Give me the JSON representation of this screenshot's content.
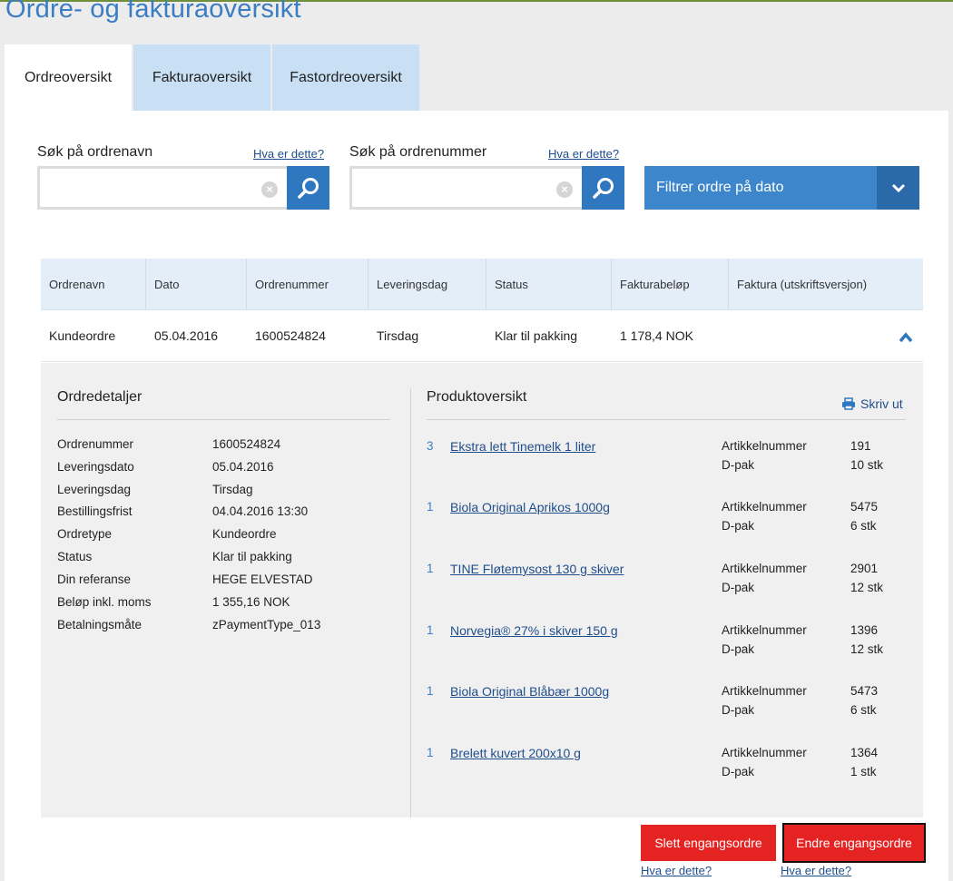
{
  "page": {
    "title": "Ordre- og fakturaoversikt"
  },
  "tabs": [
    {
      "label": "Ordreoversikt",
      "active": true
    },
    {
      "label": "Fakturaoversikt",
      "active": false
    },
    {
      "label": "Fastordreoversikt",
      "active": false
    }
  ],
  "search": {
    "order_name": {
      "label": "Søk på ordrenavn",
      "help": "Hva er dette?",
      "value": "",
      "placeholder": ""
    },
    "order_number": {
      "label": "Søk på ordrenummer",
      "help": "Hva er dette?",
      "value": "",
      "placeholder": ""
    },
    "date_filter_label": "Filtrer ordre på dato"
  },
  "table": {
    "headers": [
      "Ordrenavn",
      "Dato",
      "Ordrenummer",
      "Leveringsdag",
      "Status",
      "Fakturabeløp",
      "Faktura (utskriftsversjon)"
    ],
    "rows": [
      {
        "ordrenavn": "Kundeordre",
        "dato": "05.04.2016",
        "ordrenummer": "1600524824",
        "leveringsdag": "Tirsdag",
        "status": "Klar til pakking",
        "fakturabelop": "1 178,4 NOK",
        "faktura": ""
      }
    ]
  },
  "order_details": {
    "title": "Ordredetaljer",
    "fields": [
      {
        "key": "Ordrenummer",
        "value": "1600524824"
      },
      {
        "key": "Leveringsdato",
        "value": "05.04.2016"
      },
      {
        "key": "Leveringsdag",
        "value": "Tirsdag"
      },
      {
        "key": "Bestillingsfrist",
        "value": "04.04.2016 13:30"
      },
      {
        "key": "Ordretype",
        "value": "Kundeordre"
      },
      {
        "key": "Status",
        "value": "Klar til pakking"
      },
      {
        "key": "Din referanse",
        "value": "HEGE ELVESTAD"
      },
      {
        "key": "Beløp inkl. moms",
        "value": "1 355,16 NOK"
      },
      {
        "key": "Betalningsmåte",
        "value": "zPaymentType_013"
      }
    ]
  },
  "products": {
    "title": "Produktoversikt",
    "print_label": "Skriv ut",
    "article_label": "Artikkelnummer",
    "pack_label": "D-pak",
    "items": [
      {
        "qty": "3",
        "name": "Ekstra lett Tinemelk 1 liter",
        "article": "191",
        "pack": "10 stk"
      },
      {
        "qty": "1",
        "name": "Biola Original Aprikos 1000g",
        "article": "5475",
        "pack": "6 stk"
      },
      {
        "qty": "1",
        "name": "TINE Fløtemysost 130 g skiver",
        "article": "2901",
        "pack": "12 stk"
      },
      {
        "qty": "1",
        "name": "Norvegia® 27% i skiver 150 g",
        "article": "1396",
        "pack": "12 stk"
      },
      {
        "qty": "1",
        "name": "Biola Original Blåbær 1000g",
        "article": "5473",
        "pack": "6 stk"
      },
      {
        "qty": "1",
        "name": "Brelett kuvert 200x10 g",
        "article": "1364",
        "pack": "1 stk"
      }
    ]
  },
  "actions": {
    "delete_label": "Slett engangsordre",
    "edit_label": "Endre engangsordre",
    "help": "Hva er dette?"
  },
  "colors": {
    "accent": "#3b7dc4",
    "button_red": "#e52322",
    "tab_inactive": "#c9e0f4"
  }
}
